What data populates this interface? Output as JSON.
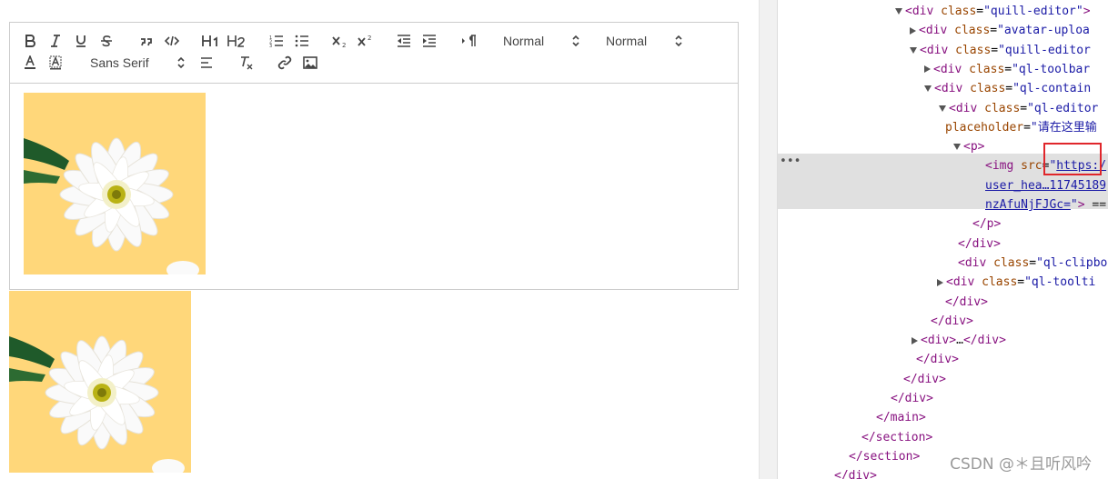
{
  "toolbar": {
    "header_select": "Normal",
    "size_select": "Normal",
    "font_select": "Sans Serif"
  },
  "devtools": {
    "lines": [
      {
        "open": true,
        "html": "<span class='tag'>&lt;div</span> <span class='attr'>class</span>=<span class='val'>\"quill-editor\"</span><span class='tag'>&gt;</span>"
      },
      {
        "closed": true,
        "html": "<span class='tag'>&lt;div</span> <span class='attr'>class</span>=<span class='val'>\"avatar-uploa</span>"
      },
      {
        "open": true,
        "html": "<span class='tag'>&lt;div</span> <span class='attr'>class</span>=<span class='val'>\"quill-editor</span>"
      },
      {
        "closed": true,
        "html": "<span class='tag'>&lt;div</span> <span class='attr'>class</span>=<span class='val'>\"ql-toolbar</span>"
      },
      {
        "open": true,
        "html": "<span class='tag'>&lt;div</span> <span class='attr'>class</span>=<span class='val'>\"ql-contain</span>"
      },
      {
        "open": true,
        "html": "<span class='tag'>&lt;div</span> <span class='attr'>class</span>=<span class='val'>\"ql-editor</span>"
      },
      {
        "html": "<span class='attr'>placeholder</span>=<span class='val'>\"请在这里输</span>"
      },
      {
        "open": true,
        "html": "<span class='tag'>&lt;p&gt;</span>"
      },
      {
        "html": "<span class='tag'>&lt;img</span> <span class='attr'>src</span>=<span class='val'>\"</span><span class='link'>https:/</span>"
      },
      {
        "html": "<span class='link'>user_hea…11745189</span>"
      },
      {
        "html": "<span class='link'>nzAfuNjFJGc=</span><span class='val'>\"</span><span class='tag'>&gt;</span> <span class='txt'>==</span>"
      },
      {
        "html": "<span class='tag'>&lt;/p&gt;</span>"
      },
      {
        "html": "<span class='tag'>&lt;/div&gt;</span>"
      },
      {
        "html": "<span class='tag'>&lt;div</span> <span class='attr'>class</span>=<span class='val'>\"ql-clipbo</span>"
      },
      {
        "closed": true,
        "html": "<span class='tag'>&lt;div</span> <span class='attr'>class</span>=<span class='val'>\"ql-toolti</span>"
      },
      {
        "html": "<span class='tag'>&lt;/div&gt;</span>"
      },
      {
        "html": "<span class='tag'>&lt;/div&gt;</span>"
      },
      {
        "closed": true,
        "html": "<span class='tag'>&lt;div&gt;</span><span class='txt'>…</span><span class='tag'>&lt;/div&gt;</span>"
      },
      {
        "html": "<span class='tag'>&lt;/div&gt;</span>"
      },
      {
        "html": "<span class='tag'>&lt;/div&gt;</span>"
      },
      {
        "html": "<span class='tag'>&lt;/div&gt;</span>"
      },
      {
        "html": "<span class='tag'>&lt;/main&gt;</span>"
      },
      {
        "html": "<span class='tag'>&lt;/section&gt;</span>"
      },
      {
        "html": "<span class='tag'>&lt;/section&gt;</span>"
      },
      {
        "html": "<span class='tag'>&lt;/div&gt;</span>"
      }
    ],
    "more": "•••"
  },
  "watermark": "CSDN @＊且听风吟"
}
